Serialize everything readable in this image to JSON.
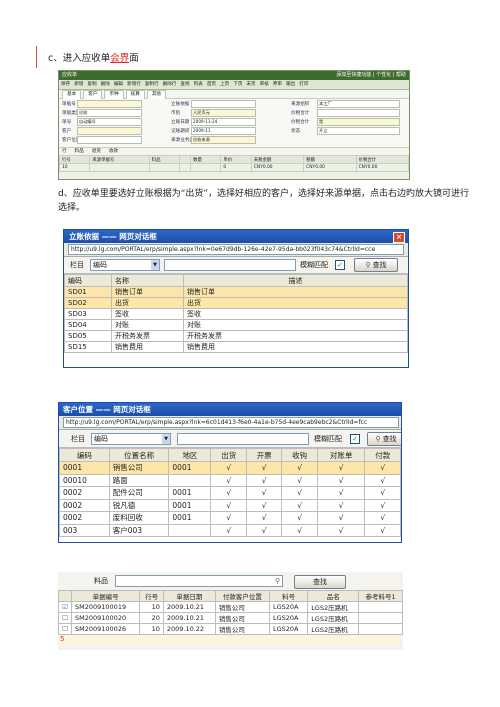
{
  "section_c": {
    "prefix": "c、进入应收单",
    "mark": "会界",
    "suffix": "面"
  },
  "section_d": {
    "text": "d、应收单里要选好立账根据为“出货”，选择好相应的客户，选择好来源单据，点击右边旳放大镜可进行选择。"
  },
  "ar_form": {
    "window_title": "应收单",
    "window_right": "添加至快捷功能  |  个性化  |  帮助",
    "menu": [
      "保存",
      "新增",
      "复制",
      "删除",
      "编辑",
      "新增行",
      "复制行",
      "删除行",
      "查找",
      "列表",
      "首页",
      "上页",
      "下页",
      "末页",
      "审核",
      "弃审",
      "输出",
      "打印"
    ],
    "tabs": [
      "基本",
      "客户",
      "币种",
      "核算",
      "其他"
    ],
    "fields": [
      {
        "label": "单据号",
        "value": ""
      },
      {
        "label": "单据类型",
        "value": "应收"
      },
      {
        "label": "单号",
        "value": "自动编号"
      },
      {
        "label": "客户",
        "value": ""
      },
      {
        "label": "客户位置",
        "value": ""
      },
      {
        "label": "立账依据",
        "value": ""
      },
      {
        "label": "币别",
        "value": "人民币元"
      },
      {
        "label": "立账日期",
        "value": "2009-11-24"
      },
      {
        "label": "记账期间",
        "value": "2009-11"
      },
      {
        "label": "来源业务类型",
        "value": "应收来源"
      },
      {
        "label": "来源组织",
        "value": "本工厂"
      },
      {
        "label": "价税合计",
        "value": ""
      },
      {
        "label": "价税合计",
        "value": "是"
      },
      {
        "label": "状态",
        "value": "开立"
      }
    ],
    "grid_tabs": [
      "行",
      "料品",
      "退货",
      "收款"
    ],
    "grid_columns": [
      "行号",
      "来源单据号",
      "料品",
      "",
      "数量",
      "单价",
      "未税金额",
      "税额",
      "价税合计"
    ],
    "grid_rows": [
      [
        "10",
        "",
        "",
        "",
        "",
        "0",
        "CNY0.00",
        "CNY0.00",
        "CNY0.00"
      ]
    ]
  },
  "dlg1": {
    "title": "立账依据 —— 网页对话框",
    "url": "http://u9.lg.com/PORTAL/erp/simple.aspx?lnk=0e67d9db-126e-42e7-95da-bb023f043c74&CtrlId=cce",
    "column_label": "栏目",
    "column_value": "编码",
    "fuzzy_label": "模糊匹配",
    "search_label": "查找",
    "headers": [
      "编码",
      "名称",
      "描述"
    ],
    "rows": [
      [
        "SD01",
        "销售订单",
        "销售订单"
      ],
      [
        "SD02",
        "出货",
        "出货"
      ],
      [
        "SD03",
        "签收",
        "签收"
      ],
      [
        "SD04",
        "对账",
        "对账"
      ],
      [
        "SD05",
        "开税务发票",
        "开税务发票"
      ],
      [
        "SD15",
        "销售费用",
        "销售费用"
      ]
    ]
  },
  "dlg2": {
    "title": "客户位置 —— 网页对话框",
    "url": "http://u9.lg.com/PORTAL/erp/simple.aspx?lnk=6c01d413-f6e0-4a1e-b75d-4ee9cab9ebc2&CtrlId=fcc",
    "column_label": "栏目",
    "column_value": "编码",
    "fuzzy_label": "模糊匹配",
    "search_label": "查找",
    "headers": [
      "编码",
      "位置名称",
      "地区",
      "出货",
      "开票",
      "收钩",
      "对账单",
      "付款"
    ],
    "rows": [
      [
        "0001",
        "销售公司",
        "0001",
        "√",
        "√",
        "√",
        "√",
        "√"
      ],
      [
        "00010",
        "路面",
        "",
        "√",
        "√",
        "√",
        "√",
        "√"
      ],
      [
        "0002",
        "配件公司",
        "0001",
        "√",
        "√",
        "√",
        "√",
        "√"
      ],
      [
        "0002",
        "锐凡德",
        "0001",
        "√",
        "√",
        "√",
        "√",
        "√"
      ],
      [
        "0002",
        "废料回收",
        "0001",
        "√",
        "√",
        "√",
        "√",
        "√"
      ],
      [
        "003",
        "客户003",
        "",
        "√",
        "√",
        "√",
        "√",
        "√"
      ]
    ]
  },
  "list3": {
    "item_label": "料品",
    "search_label": "查找",
    "headers": [
      "单据编号",
      "行号",
      "单据日期",
      "付款客户位置",
      "料号",
      "品名",
      "参考料号1"
    ],
    "rows": [
      {
        "checked": true,
        "cells": [
          "SM2009100019",
          "10",
          "2009.10.21",
          "销售公司",
          "LGS20A",
          "LGS2压路机",
          ""
        ]
      },
      {
        "checked": false,
        "cells": [
          "SM2009100020",
          "20",
          "2009.10.21",
          "销售公司",
          "LGS20A",
          "LGS2压路机",
          ""
        ]
      },
      {
        "checked": false,
        "cells": [
          "SM2009100026",
          "10",
          "2009.10.22",
          "销售公司",
          "LGS20A",
          "LGS2压路机",
          ""
        ]
      }
    ],
    "footer": "5"
  }
}
